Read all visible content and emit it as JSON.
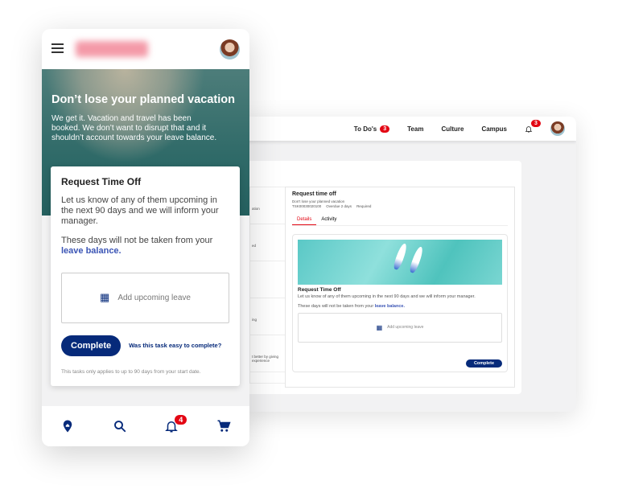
{
  "desktop": {
    "nav": [
      {
        "label": "To Do's",
        "badge": "3"
      },
      {
        "label": "Team"
      },
      {
        "label": "Culture"
      },
      {
        "label": "Campus"
      }
    ],
    "notifications_badge": "3",
    "left_list_fragments": [
      "ation",
      "ed",
      "",
      "ing",
      "t better by giving experience"
    ],
    "detail": {
      "title": "Request time off",
      "subtitle": "Don't lose your planned vacation",
      "task_id": "TSK00030020100",
      "overdue": "Overdue 2 days",
      "required": "Required",
      "tabs": [
        "Details",
        "Activity"
      ],
      "active_tab": "Details",
      "card_title": "Request Time Off",
      "card_text": "Let us know of any of them upcoming in the next 90 days and we will inform your manager.",
      "balance_text": "These days will not be taken from your ",
      "balance_link": "leave balance.",
      "add_leave": "Add upcoming leave",
      "complete": "Complete"
    }
  },
  "mobile": {
    "hero_title": "Don’t lose your planned vacation",
    "hero_text": "We get it. Vacation and travel has been booked. We don’t want to disrupt that and it shouldn’t account towards your leave balance.",
    "card_title": "Request Time Off",
    "card_text": "Let us know of any of them upcoming in the next 90 days and we will inform your manager.",
    "balance_text": "These days will not be taken from your ",
    "balance_link": "leave balance.",
    "add_leave": "Add upcoming leave",
    "complete": "Complete",
    "feedback_link": "Was this task easy to complete?",
    "note": "This tasks only applies to up to 90 days from your start date.",
    "bottom_nav": [
      "home-icon",
      "search-icon",
      "bell-icon",
      "cart-icon"
    ],
    "notifications_badge": "4"
  },
  "colors": {
    "primary": "#062a7a",
    "badge": "#e30613",
    "link": "#3b55b5"
  }
}
